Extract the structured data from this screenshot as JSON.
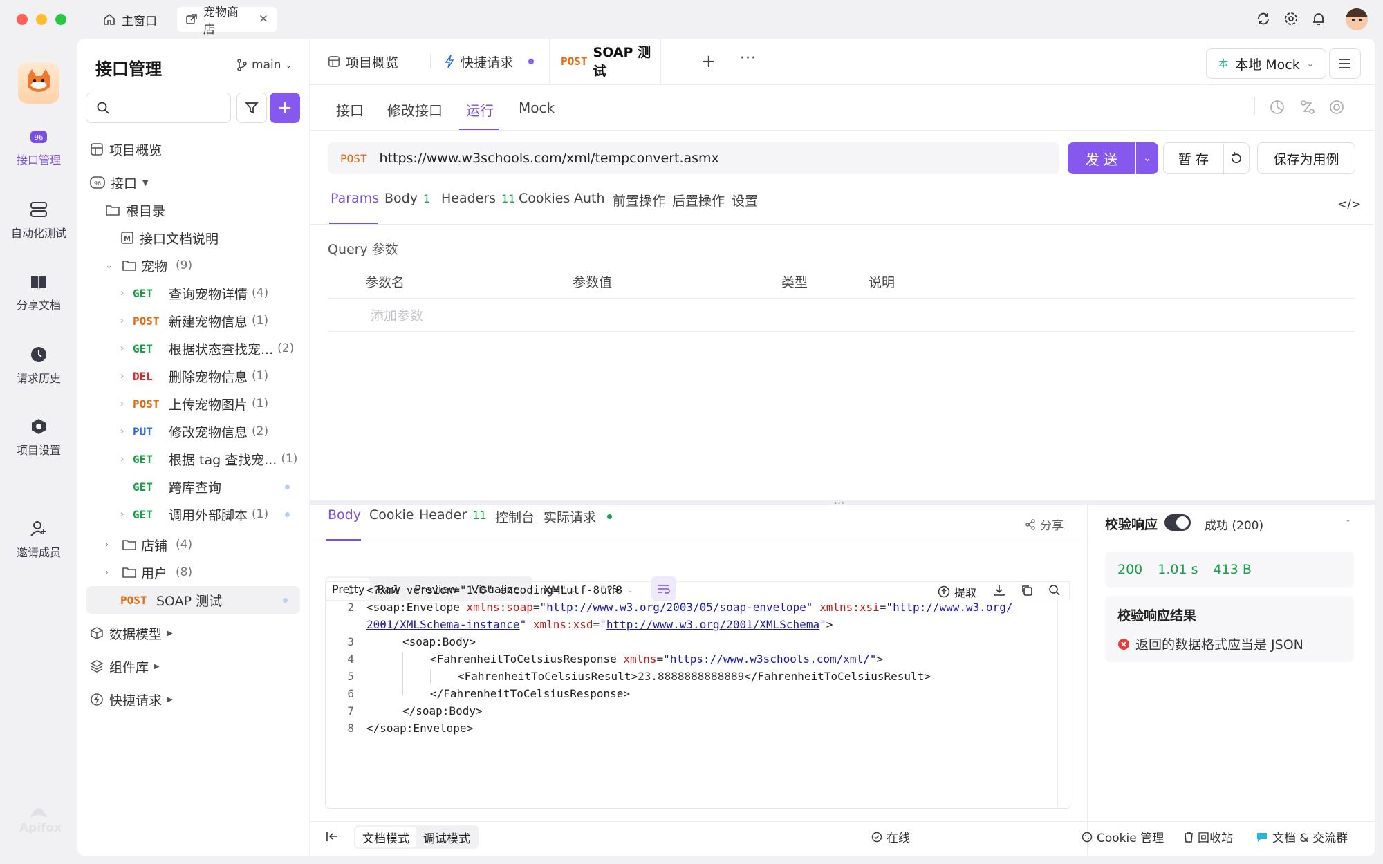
{
  "window": {
    "tabs": [
      {
        "label": "主窗口"
      },
      {
        "label": "宠物商店"
      }
    ]
  },
  "rail": {
    "app_name": "Apifox",
    "items": [
      {
        "label": "接口管理",
        "icon": "api-icon"
      },
      {
        "label": "自动化测试",
        "icon": "automation-icon"
      },
      {
        "label": "分享文档",
        "icon": "book-icon"
      },
      {
        "label": "请求历史",
        "icon": "clock-icon"
      },
      {
        "label": "项目设置",
        "icon": "settings-icon"
      },
      {
        "label": "邀请成员",
        "icon": "user-add-icon"
      }
    ]
  },
  "sidebar": {
    "title": "接口管理",
    "branch": "main",
    "overview": "项目概览",
    "api_root": "接口",
    "root_dir": "根目录",
    "doc": "接口文档说明",
    "folder_pets": {
      "label": "宠物",
      "count": "(9)"
    },
    "endpoints": [
      {
        "method": "GET",
        "name": "查询宠物详情",
        "count": "(4)"
      },
      {
        "method": "POST",
        "name": "新建宠物信息",
        "count": "(1)"
      },
      {
        "method": "GET",
        "name": "根据状态查找宠...",
        "count": "(2)"
      },
      {
        "method": "DEL",
        "name": "删除宠物信息",
        "count": "(1)"
      },
      {
        "method": "POST",
        "name": "上传宠物图片",
        "count": "(1)"
      },
      {
        "method": "PUT",
        "name": "修改宠物信息",
        "count": "(2)"
      },
      {
        "method": "GET",
        "name": "根据 tag 查找宠...",
        "count": "(1)"
      },
      {
        "method": "GET",
        "name": "跨库查询",
        "count": ""
      },
      {
        "method": "GET",
        "name": "调用外部脚本",
        "count": "(1)"
      }
    ],
    "folder_store": {
      "label": "店铺",
      "count": "(4)"
    },
    "folder_user": {
      "label": "用户",
      "count": "(8)"
    },
    "active": {
      "method": "POST",
      "name": "SOAP 测试"
    },
    "data_model": "数据模型",
    "components": "组件库",
    "quick_request": "快捷请求"
  },
  "page_tabs": [
    {
      "label": "项目概览"
    },
    {
      "label": "快捷请求"
    },
    {
      "method": "POST",
      "label": "SOAP 测试"
    }
  ],
  "env": {
    "label": "本地 Mock",
    "badge": "本"
  },
  "sub_tabs": [
    "接口",
    "修改接口",
    "运行",
    "Mock"
  ],
  "request": {
    "method": "POST",
    "url": "https://www.w3schools.com/xml/tempconvert.asmx",
    "send": "发 送",
    "save_temp": "暂 存",
    "save_case": "保存为用例"
  },
  "req_tabs": [
    {
      "label": "Params",
      "count": ""
    },
    {
      "label": "Body",
      "count": "1"
    },
    {
      "label": "Headers",
      "count": "11"
    },
    {
      "label": "Cookies",
      "count": ""
    },
    {
      "label": "Auth",
      "count": ""
    },
    {
      "label": "前置操作",
      "count": ""
    },
    {
      "label": "后置操作",
      "count": ""
    },
    {
      "label": "设置",
      "count": ""
    }
  ],
  "params": {
    "section": "Query 参数",
    "columns": [
      "参数名",
      "参数值",
      "类型",
      "说明"
    ],
    "add_placeholder": "添加参数"
  },
  "response": {
    "tabs": [
      {
        "label": "Body",
        "count": ""
      },
      {
        "label": "Cookie",
        "count": ""
      },
      {
        "label": "Header",
        "count": "11"
      },
      {
        "label": "控制台",
        "count": ""
      },
      {
        "label": "实际请求",
        "count": ""
      }
    ],
    "share": "分享",
    "view_modes": [
      "Pretty",
      "Raw",
      "Preview",
      "Visualize"
    ],
    "format": "XML",
    "encoding": "utf8",
    "extract": "提取",
    "code_lines": [
      "1",
      "2",
      "3",
      "4",
      "5",
      "6",
      "7",
      "8"
    ],
    "xml": {
      "l1": "<?xml version=\"1.0\" encoding=\"utf-8\"?>",
      "ns_soap": "http://www.w3.org/2003/05/soap-envelope",
      "ns_xsi_a": "http://www.w3.org/",
      "ns_xsi_b": "2001/XMLSchema-instance",
      "ns_xsd": "http://www.w3.org/2001/XMLSchema",
      "ns_w3": "https://www.w3schools.com/xml/",
      "result": "23.8888888888889"
    }
  },
  "validate": {
    "label": "校验响应",
    "status": "成功 (200)",
    "code": "200",
    "time": "1.01 s",
    "size": "413 B",
    "result_title": "校验响应结果",
    "result_msg": "返回的数据格式应当是 JSON"
  },
  "footer": {
    "doc_mode": "文档模式",
    "debug_mode": "调试模式",
    "online": "在线",
    "cookie": "Cookie 管理",
    "trash": "回收站",
    "community": "文档 & 交流群"
  }
}
